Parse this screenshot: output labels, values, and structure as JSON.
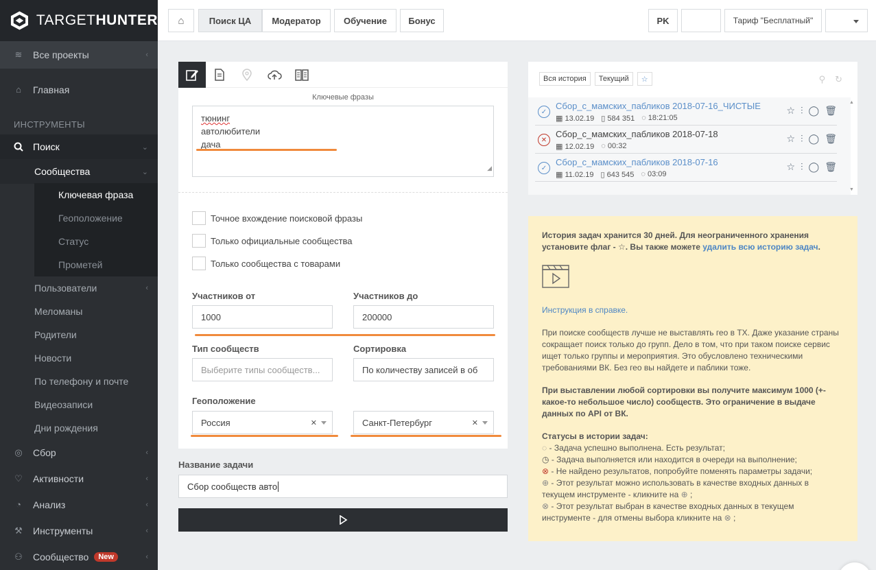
{
  "brand": {
    "name_light": "TARGET",
    "name_bold": "HUNTER"
  },
  "sidebar": {
    "all_projects": "Все проекты",
    "home": "Главная",
    "section_tools": "ИНСТРУМЕНТЫ",
    "search": "Поиск",
    "communities": "Сообщества",
    "sub_items": [
      "Ключевая фраза",
      "Геоположение",
      "Статус",
      "Прометей"
    ],
    "plain_items": [
      "Пользователи",
      "Меломаны",
      "Родители",
      "Новости",
      "По телефону и почте",
      "Видеозаписи",
      "Дни рождения"
    ],
    "bottom_items": [
      "Сбор",
      "Активности",
      "Анализ",
      "Инструменты",
      "Сообщество"
    ],
    "new_badge": "New"
  },
  "topbar": {
    "tabs": [
      "Поиск ЦА",
      "Модератор",
      "Обучение",
      "Бонус"
    ],
    "pk": "PK",
    "tariff": "Тариф \"Бесплатный\""
  },
  "form": {
    "keywords_label": "Ключевые фразы",
    "keywords": [
      "тюнинг",
      "автолюбители",
      "дача"
    ],
    "checkboxes": [
      "Точное вхождение поисковой фразы",
      "Только официальные сообщества",
      "Только сообщества с товарами"
    ],
    "members_from_label": "Участников от",
    "members_from": "1000",
    "members_to_label": "Участников до",
    "members_to": "200000",
    "type_label": "Тип сообществ",
    "type_placeholder": "Выберите типы сообществ...",
    "sort_label": "Сортировка",
    "sort_value": "По количеству записей в об",
    "geo_label": "Геоположение",
    "country": "Россия",
    "city": "Санкт-Петербург",
    "task_label": "Название задачи",
    "task_value": "Сбор сообществ авто"
  },
  "history": {
    "filter_all": "Вся история",
    "filter_current": "Текущий",
    "rows": [
      {
        "name": "Сбор_с_мамских_пабликов 2018-07-16_ЧИСТЫЕ",
        "date": "13.02.19",
        "count": "584 351",
        "time": "18:21:05",
        "status": "ok"
      },
      {
        "name": "Сбор_с_мамских_пабликов 2018-07-18",
        "date": "12.02.19",
        "count": "",
        "time": "00:32",
        "status": "error"
      },
      {
        "name": "Сбор_с_мамских_пабликов 2018-07-16",
        "date": "11.02.19",
        "count": "643 545",
        "time": "03:09",
        "status": "ok"
      }
    ]
  },
  "info": {
    "p1": "История задач хранится 30 дней. Для неограниченного хранения установите флаг - ☆. Вы также можете ",
    "p1_link": "удалить всю историю задач",
    "p1_end": ".",
    "instruction_link": "Инструкция в справке.",
    "p2": "При поиске сообществ лучше не выставлять гео в ТХ. Даже указание страны сокращает поиск только до групп. Дело в том, что при таком поиске сервис ищет только группы и мероприятия. Это обусловлено техническими требованиями ВК. Без гео вы найдете и паблики тоже.",
    "p3": "При выставлении любой сортировки вы получите максимум 1000 (+- какое-то небольшое число) сообществ. Это ограничение в выдаче данных по API от ВК.",
    "statuses_title": "Статусы в истории задач:",
    "statuses": [
      "- Задача успешно выполнена. Есть результат;",
      "- Задача выполняется или находится в очереди на выполнение;",
      "- Не найдено результатов, попробуйте поменять параметры задачи;",
      "- Этот результат можно использовать в качестве входных данных в текущем инструменте - кликните на",
      "- Этот результат выбран в качестве входных данных в текущем инструменте - для отмены выбора кликните на"
    ]
  }
}
